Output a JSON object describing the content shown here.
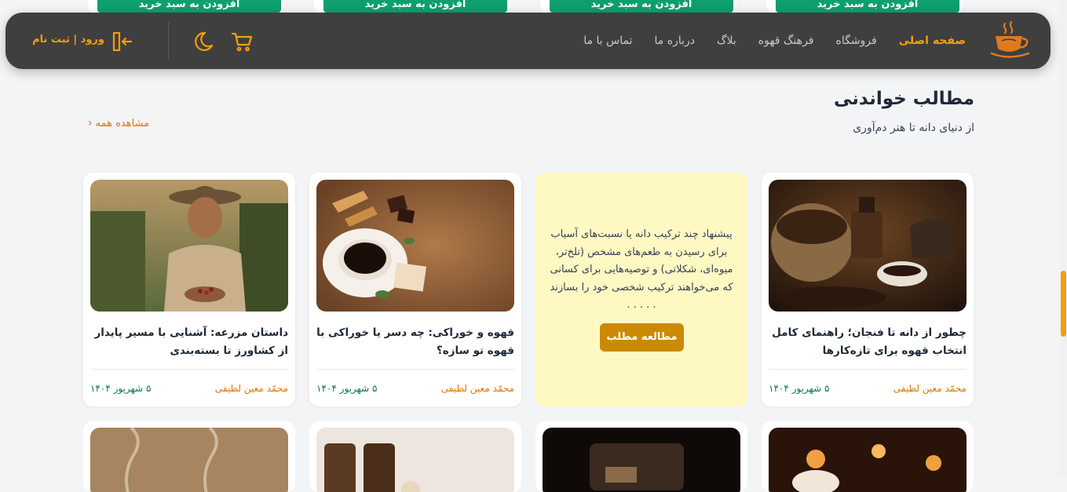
{
  "top_strip": {
    "cart_label": "افزودن به سبد خرید"
  },
  "header": {
    "nav": [
      {
        "label": "صفحه اصلی",
        "active": true
      },
      {
        "label": "فروشگاه",
        "active": false
      },
      {
        "label": "فرهنگ قهوه",
        "active": false
      },
      {
        "label": "بلاگ",
        "active": false
      },
      {
        "label": "درباره ما",
        "active": false
      },
      {
        "label": "تماس با ما",
        "active": false
      }
    ],
    "login_label": "ورود | ثبت نام",
    "icons": {
      "logo": "coffee-cup-logo",
      "cart": "cart-icon",
      "theme": "moon-icon",
      "login": "login-icon"
    },
    "accent_color": "#f59e0b"
  },
  "section": {
    "title": "مطالب خواندنی",
    "subtitle": "از دنیای دانه تا هنر دم‌آوری",
    "view_all": "مشاهده همه"
  },
  "cards": [
    {
      "title": "چطور از دانه تا فنجان؛ راهنمای کامل انتخاب قهوه برای تازه‌کارها",
      "author": "محمّد معین لطیفی",
      "date": "۵ شهریور ۱۴۰۴"
    },
    {
      "promo_text": "پیشنهاد چند ترکیب دانه یا نسبت‌های آسیاب برای رسیدن به طعم‌های مشخص (تلخ‌تر، میوه‌ای، شکلاتی) و توصیه‌هایی برای کسانی که می‌خواهند ترکیب شخصی خود را بسازند . . . . .",
      "button": "مطالعه مطلب"
    },
    {
      "title": "قهوه و خوراکی: چه دسر یا خوراکی با قهوه تو سازه؟",
      "author": "محمّد معین لطیفی",
      "date": "۵ شهریور ۱۴۰۴"
    },
    {
      "title": "داستان مزرعه: آشنایی با مسیر پایدار از کشاورز تا بسته‌بندی",
      "author": "محمّد معین لطیفی",
      "date": "۵ شهریور ۱۴۰۴"
    }
  ]
}
